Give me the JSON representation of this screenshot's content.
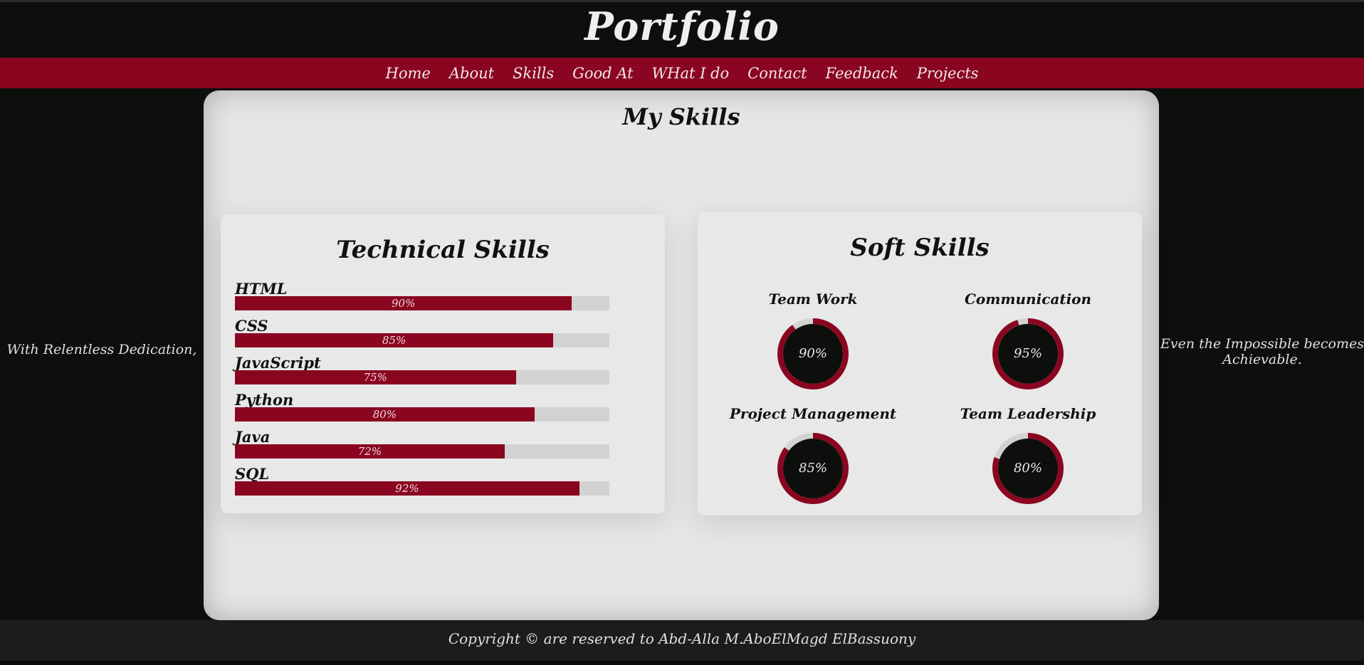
{
  "header": {
    "title": "Portfolio"
  },
  "nav": {
    "items": [
      {
        "label": "Home"
      },
      {
        "label": "About"
      },
      {
        "label": "Skills"
      },
      {
        "label": "Good At"
      },
      {
        "label": "WHat I do"
      },
      {
        "label": "Contact"
      },
      {
        "label": "Feedback"
      },
      {
        "label": "Projects"
      }
    ]
  },
  "side": {
    "left": "With Relentless Dedication,",
    "right": "Even the Impossible becomes Achievable."
  },
  "skills": {
    "title": "My Skills",
    "technical": {
      "title": "Technical Skills",
      "items": [
        {
          "name": "HTML",
          "percent": 90,
          "label": "90%"
        },
        {
          "name": "CSS",
          "percent": 85,
          "label": "85%"
        },
        {
          "name": "JavaScript",
          "percent": 75,
          "label": "75%"
        },
        {
          "name": "Python",
          "percent": 80,
          "label": "80%"
        },
        {
          "name": "Java",
          "percent": 72,
          "label": "72%"
        },
        {
          "name": "SQL",
          "percent": 92,
          "label": "92%"
        }
      ]
    },
    "soft": {
      "title": "Soft Skills",
      "items": [
        {
          "name": "Team Work",
          "percent": 90,
          "label": "90%"
        },
        {
          "name": "Communication",
          "percent": 95,
          "label": "95%"
        },
        {
          "name": "Project Management",
          "percent": 85,
          "label": "85%"
        },
        {
          "name": "Team Leadership",
          "percent": 80,
          "label": "80%"
        }
      ]
    }
  },
  "footer": {
    "text": "Copyright © are reserved to Abd-Alla M.AboElMagd ElBassuony"
  },
  "colors": {
    "accent": "#8a0620",
    "background": "#0c0f0c",
    "card": "#e6e6e6",
    "track": "#d2d2d2"
  }
}
